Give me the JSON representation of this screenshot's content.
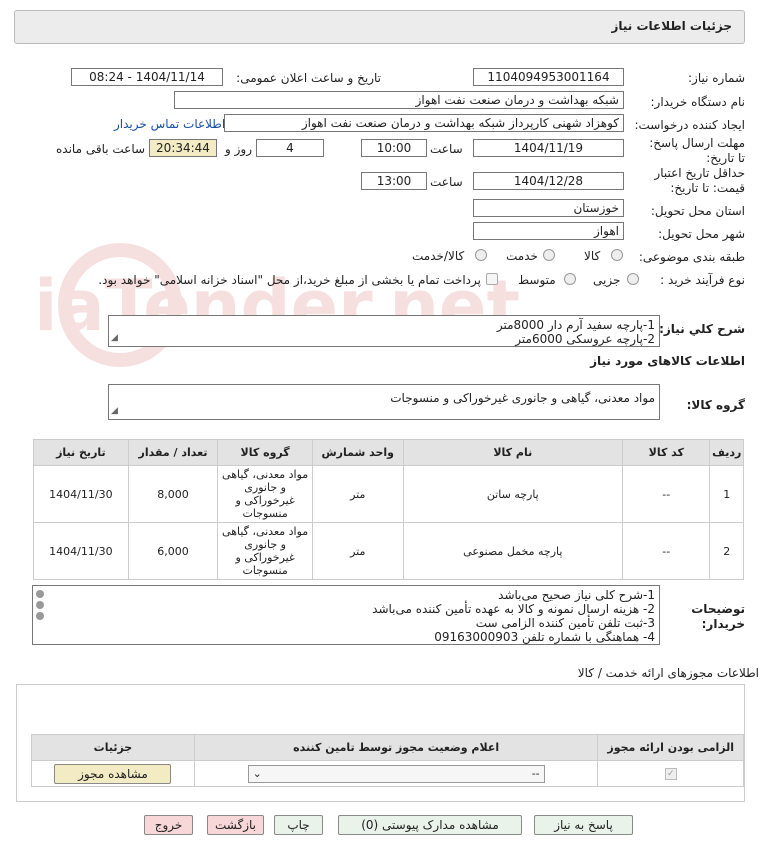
{
  "header": {
    "title": "جزئیات اطلاعات نیاز"
  },
  "form": {
    "need_number_label": "شماره نیاز:",
    "need_number": "1104094953001164",
    "announce_label": "تاریخ و ساعت اعلان عمومی:",
    "announce_value": "1404/11/14 - 08:24",
    "buyer_org_label": "نام دستگاه خریدار:",
    "buyer_org": "شبکه بهداشت و درمان صنعت نفت اهواز",
    "requester_label": "ایجاد کننده درخواست:",
    "requester": "کوهزاد شهنی کارپرداز شبکه بهداشت و درمان صنعت نفت اهواز",
    "contact_link": "اطلاعات تماس خریدار",
    "deadline_label": "مهلت ارسال پاسخ: تا تاریخ:",
    "deadline_date": "1404/11/19",
    "time_label": "ساعت",
    "deadline_time": "10:00",
    "days_value": "4",
    "days_label": "روز و",
    "remaining_time": "20:34:44",
    "remaining_label": "ساعت باقی مانده",
    "validity_label": "حداقل تاریخ اعتبار قیمت: تا تاریخ:",
    "validity_date": "1404/12/28",
    "validity_time": "13:00",
    "province_label": "استان محل تحویل:",
    "province": "خوزستان",
    "city_label": "شهر محل تحویل:",
    "city": "اهواز",
    "category_label": "طبقه بندی موضوعی:",
    "category_options": [
      "کالا",
      "خدمت",
      "کالا/خدمت"
    ],
    "process_label": "نوع فرآیند خرید :",
    "process_options": [
      "جزیی",
      "متوسط"
    ],
    "payment_note": "پرداخت تمام یا بخشی از مبلغ خرید،از محل \"اسناد خزانه اسلامی\" خواهد بود."
  },
  "general_desc": {
    "label": "شرح کلي نياز:",
    "lines": [
      "1-پارچه سفید آرم دار 8000متر",
      "2-پارچه عروسکی 6000متر"
    ]
  },
  "goods_info_title": "اطلاعات کالاهای مورد نیاز",
  "goods_group": {
    "label": "گروه کالا:",
    "value": "مواد معدنی، گیاهی و جانوری غیرخوراکی و منسوجات"
  },
  "goods_table": {
    "headers": [
      "ردیف",
      "کد کالا",
      "نام کالا",
      "واحد شمارش",
      "گروه کالا",
      "تعداد / مقدار",
      "تاریخ نیاز"
    ],
    "rows": [
      {
        "idx": "1",
        "code": "--",
        "name": "پارچه ساتن",
        "unit": "متر",
        "group": "مواد معدنی، گیاهی و جانوری غیرخوراکی و منسوجات",
        "qty": "8,000",
        "date": "1404/11/30"
      },
      {
        "idx": "2",
        "code": "--",
        "name": "پارچه مخمل مصنوعی",
        "unit": "متر",
        "group": "مواد معدنی، گیاهی و جانوری غیرخوراکی و منسوجات",
        "qty": "6,000",
        "date": "1404/11/30"
      }
    ]
  },
  "buyer_notes": {
    "label": "توضیحات خریدار:",
    "lines": [
      "1-شرح کلی نیاز صحیح می‌باشد",
      "2- هزینه ارسال نمونه و کالا به عهده تأمین کننده می‌باشد",
      "3-ثبت تلفن تأمین کننده الزامی ست",
      "4- هماهنگی با شماره تلفن 09163000903"
    ]
  },
  "permits": {
    "title": "اطلاعات مجوزهای ارائه خدمت / کالا",
    "headers": [
      "الزامی بودن ارائه مجوز",
      "اعلام وضعیت مجوز توسط تامین کننده",
      "جزئیات"
    ],
    "select_value": "--",
    "view_button": "مشاهده مجوز"
  },
  "actions": {
    "reply": "پاسخ به نیاز",
    "docs": "مشاهده مدارک پیوستی (0)",
    "print": "چاپ",
    "back": "بازگشت",
    "exit": "خروج"
  },
  "watermark_text": "AriaTender.net",
  "colors": {
    "link": "#1a4fa0",
    "yellow_box": "#f2ebc3",
    "header_bg": "#ececec",
    "button_green": "#eaf3ea",
    "button_pink": "#f7d7d7"
  }
}
